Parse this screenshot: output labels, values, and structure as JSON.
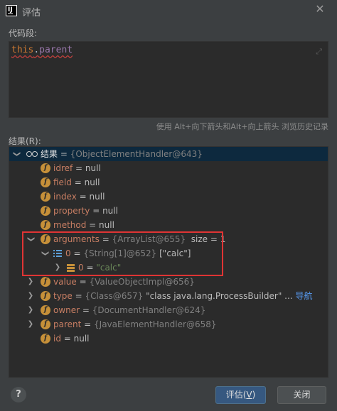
{
  "dialog": {
    "title": "评估",
    "close_glyph": "✕"
  },
  "code_section": {
    "label": "代码段:",
    "code_keyword": "this",
    "code_dot": ".",
    "code_field": "parent",
    "expand_glyph": "⤢",
    "history_hint": "使用 Alt+向下箭头和Alt+向上箭头 浏览历史记录"
  },
  "result_section": {
    "label": "结果(R):"
  },
  "tree": {
    "root": {
      "name": "结果",
      "eq": " = ",
      "ref": "{ObjectElementHandler@643}"
    },
    "rows": [
      {
        "name": "idref",
        "eq": " = ",
        "value": "null"
      },
      {
        "name": "field",
        "eq": " = ",
        "value": "null"
      },
      {
        "name": "index",
        "eq": " = ",
        "value": "null"
      },
      {
        "name": "property",
        "eq": " = ",
        "value": "null"
      },
      {
        "name": "method",
        "eq": " = ",
        "value": "null"
      },
      {
        "name": "arguments",
        "eq": " = ",
        "ref": "{ArrayList@655}",
        "extra": "  size = 1"
      },
      {
        "name": "0",
        "eq": " = ",
        "ref": "{String[1]@652}",
        "value": " [\"calc\"]"
      },
      {
        "name": "0",
        "eq": " = ",
        "str": "\"calc\""
      },
      {
        "name": "value",
        "eq": " = ",
        "ref": "{ValueObjectImpl@656}"
      },
      {
        "name": "type",
        "eq": " = ",
        "ref": "{Class@657}",
        "value": " \"class java.lang.ProcessBuilder\"",
        "more": " ... ",
        "link": "导航"
      },
      {
        "name": "owner",
        "eq": " = ",
        "ref": "{DocumentHandler@624}"
      },
      {
        "name": "parent",
        "eq": " = ",
        "ref": "{JavaElementHandler@658}"
      },
      {
        "name": "id",
        "eq": " = ",
        "value": "null"
      }
    ]
  },
  "footer": {
    "help_label": "?",
    "evaluate_label": "评估(",
    "evaluate_mnemonic": "V",
    "evaluate_close": ")",
    "close_label": "关闭"
  },
  "icons": {
    "field_icon": "f",
    "expand_arrow": "❯",
    "collapse_arrow": "❯"
  },
  "colors": {
    "background": "#3c3f41",
    "editor_bg": "#2b2b2b",
    "selection": "#0d293e",
    "field_icon": "#c69039",
    "highlight_border": "#e03434",
    "primary_button": "#365880"
  }
}
